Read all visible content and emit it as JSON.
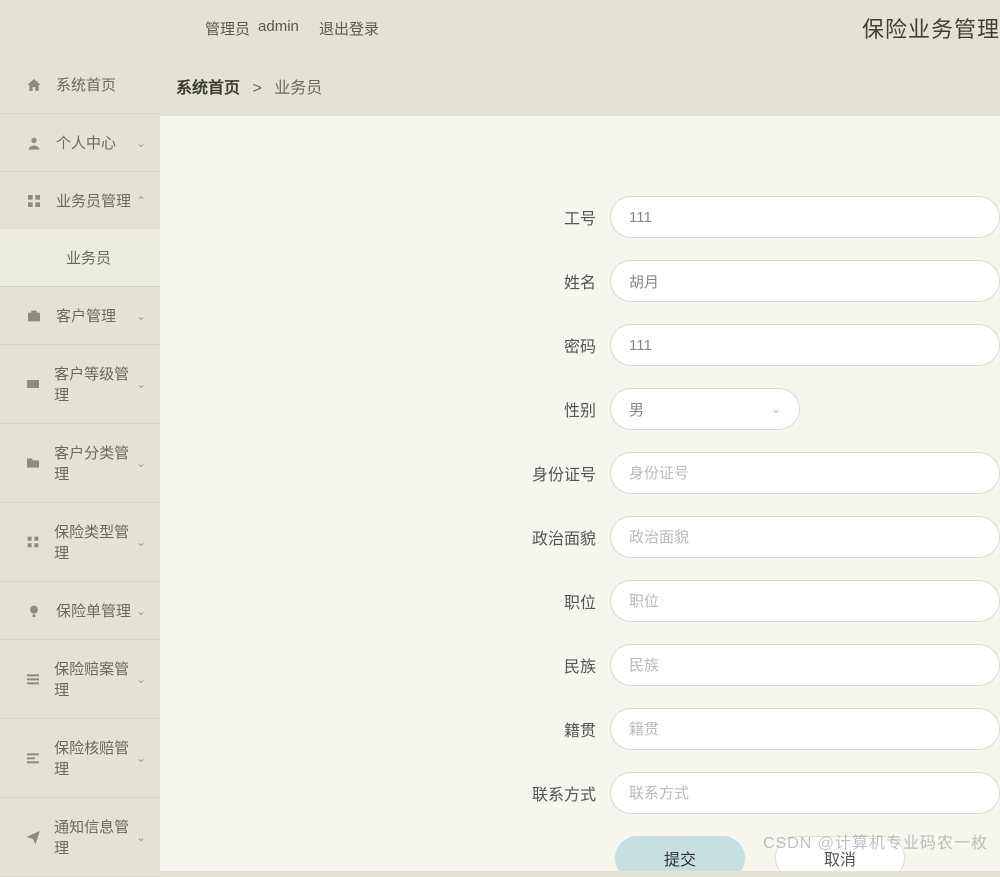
{
  "header": {
    "admin_prefix": "管理员",
    "admin_name": "admin",
    "logout": "退出登录",
    "app_title": "保险业务管理"
  },
  "sidebar": {
    "items": [
      {
        "icon": "home-icon",
        "label": "系统首页",
        "expandable": false
      },
      {
        "icon": "person-icon",
        "label": "个人中心",
        "expandable": true,
        "expanded": false
      },
      {
        "icon": "grid-icon",
        "label": "业务员管理",
        "expandable": true,
        "expanded": true,
        "children": [
          {
            "label": "业务员"
          }
        ]
      },
      {
        "icon": "briefcase-icon",
        "label": "客户管理",
        "expandable": true,
        "expanded": false
      },
      {
        "icon": "card-icon",
        "label": "客户等级管理",
        "expandable": true,
        "expanded": false
      },
      {
        "icon": "folder-icon",
        "label": "客户分类管理",
        "expandable": true,
        "expanded": false
      },
      {
        "icon": "tag-icon",
        "label": "保险类型管理",
        "expandable": true,
        "expanded": false
      },
      {
        "icon": "bulb-icon",
        "label": "保险单管理",
        "expandable": true,
        "expanded": false
      },
      {
        "icon": "list-icon",
        "label": "保险赔案管理",
        "expandable": true,
        "expanded": false
      },
      {
        "icon": "check-icon",
        "label": "保险核赔管理",
        "expandable": true,
        "expanded": false
      },
      {
        "icon": "send-icon",
        "label": "通知信息管理",
        "expandable": true,
        "expanded": false
      }
    ]
  },
  "breadcrumb": {
    "home": "系统首页",
    "sep": ">",
    "current": "业务员"
  },
  "form": {
    "fields": {
      "emp_no": {
        "label": "工号",
        "value": "111",
        "placeholder": ""
      },
      "name": {
        "label": "姓名",
        "value": "胡月",
        "placeholder": ""
      },
      "password": {
        "label": "密码",
        "value": "111",
        "placeholder": ""
      },
      "gender": {
        "label": "性别",
        "value": "男"
      },
      "id_no": {
        "label": "身份证号",
        "value": "",
        "placeholder": "身份证号"
      },
      "political": {
        "label": "政治面貌",
        "value": "",
        "placeholder": "政治面貌"
      },
      "position": {
        "label": "职位",
        "value": "",
        "placeholder": "职位"
      },
      "ethnic": {
        "label": "民族",
        "value": "",
        "placeholder": "民族"
      },
      "hometown": {
        "label": "籍贯",
        "value": "",
        "placeholder": "籍贯"
      },
      "contact": {
        "label": "联系方式",
        "value": "",
        "placeholder": "联系方式"
      }
    },
    "buttons": {
      "submit": "提交",
      "cancel": "取消"
    }
  },
  "watermark": "CSDN @计算机专业码农一枚"
}
